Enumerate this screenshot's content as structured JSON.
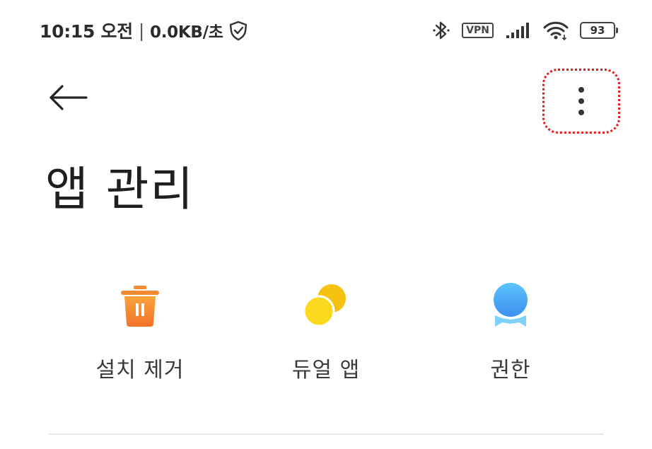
{
  "status_bar": {
    "time": "10:15 오전",
    "separator": "|",
    "network_speed": "0.0KB/초",
    "vpn": "VPN",
    "battery": "93",
    "icons": [
      "shield-icon",
      "bluetooth-icon",
      "vpn-icon",
      "signal-icon",
      "wifi-icon",
      "battery-icon"
    ]
  },
  "header": {
    "back_icon": "arrow-left-icon",
    "more_icon": "more-vertical-icon",
    "more_highlight_color": "#e21c1c"
  },
  "page": {
    "title": "앱 관리"
  },
  "shortcuts": [
    {
      "label": "설치 제거",
      "icon": "trash-icon",
      "color": "#f58a32"
    },
    {
      "label": "듀얼 앱",
      "icon": "dual-app-icon",
      "color": "#f5cc16"
    },
    {
      "label": "권한",
      "icon": "permission-icon",
      "color": "#45a8f2"
    }
  ]
}
